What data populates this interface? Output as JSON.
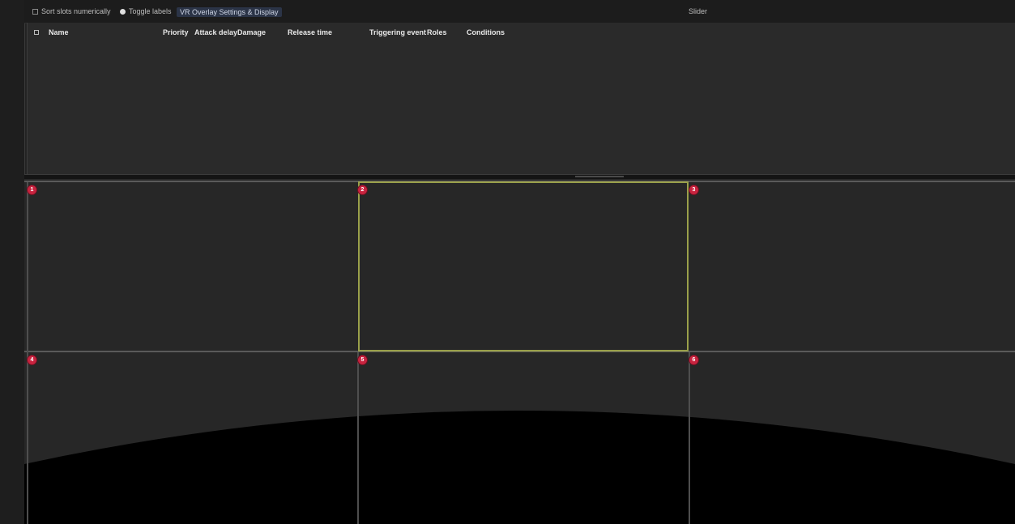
{
  "toolbar": {
    "item1_label": "Sort slots numerically",
    "item2_label": "Toggle labels",
    "item3_label": "VR Overlay Settings & Display",
    "right_label": "Slider"
  },
  "table": {
    "columns": [
      "Name",
      "Priority",
      "Attack delay",
      "Damage",
      "Release time",
      "Triggering event",
      "Roles",
      "Conditions"
    ]
  },
  "grid": {
    "markers": [
      {
        "id": "tl",
        "label": "1"
      },
      {
        "id": "tm",
        "label": "2"
      },
      {
        "id": "tr",
        "label": "3"
      },
      {
        "id": "bl",
        "label": "4"
      },
      {
        "id": "bm",
        "label": "5"
      },
      {
        "id": "br",
        "label": "6"
      }
    ],
    "selection_color": "#9aa04a",
    "marker_color": "#c8233f"
  },
  "colors": {
    "background": "#232323",
    "panel": "#2a2a2a",
    "viewport": "#272727",
    "curve_fill": "#000000"
  }
}
